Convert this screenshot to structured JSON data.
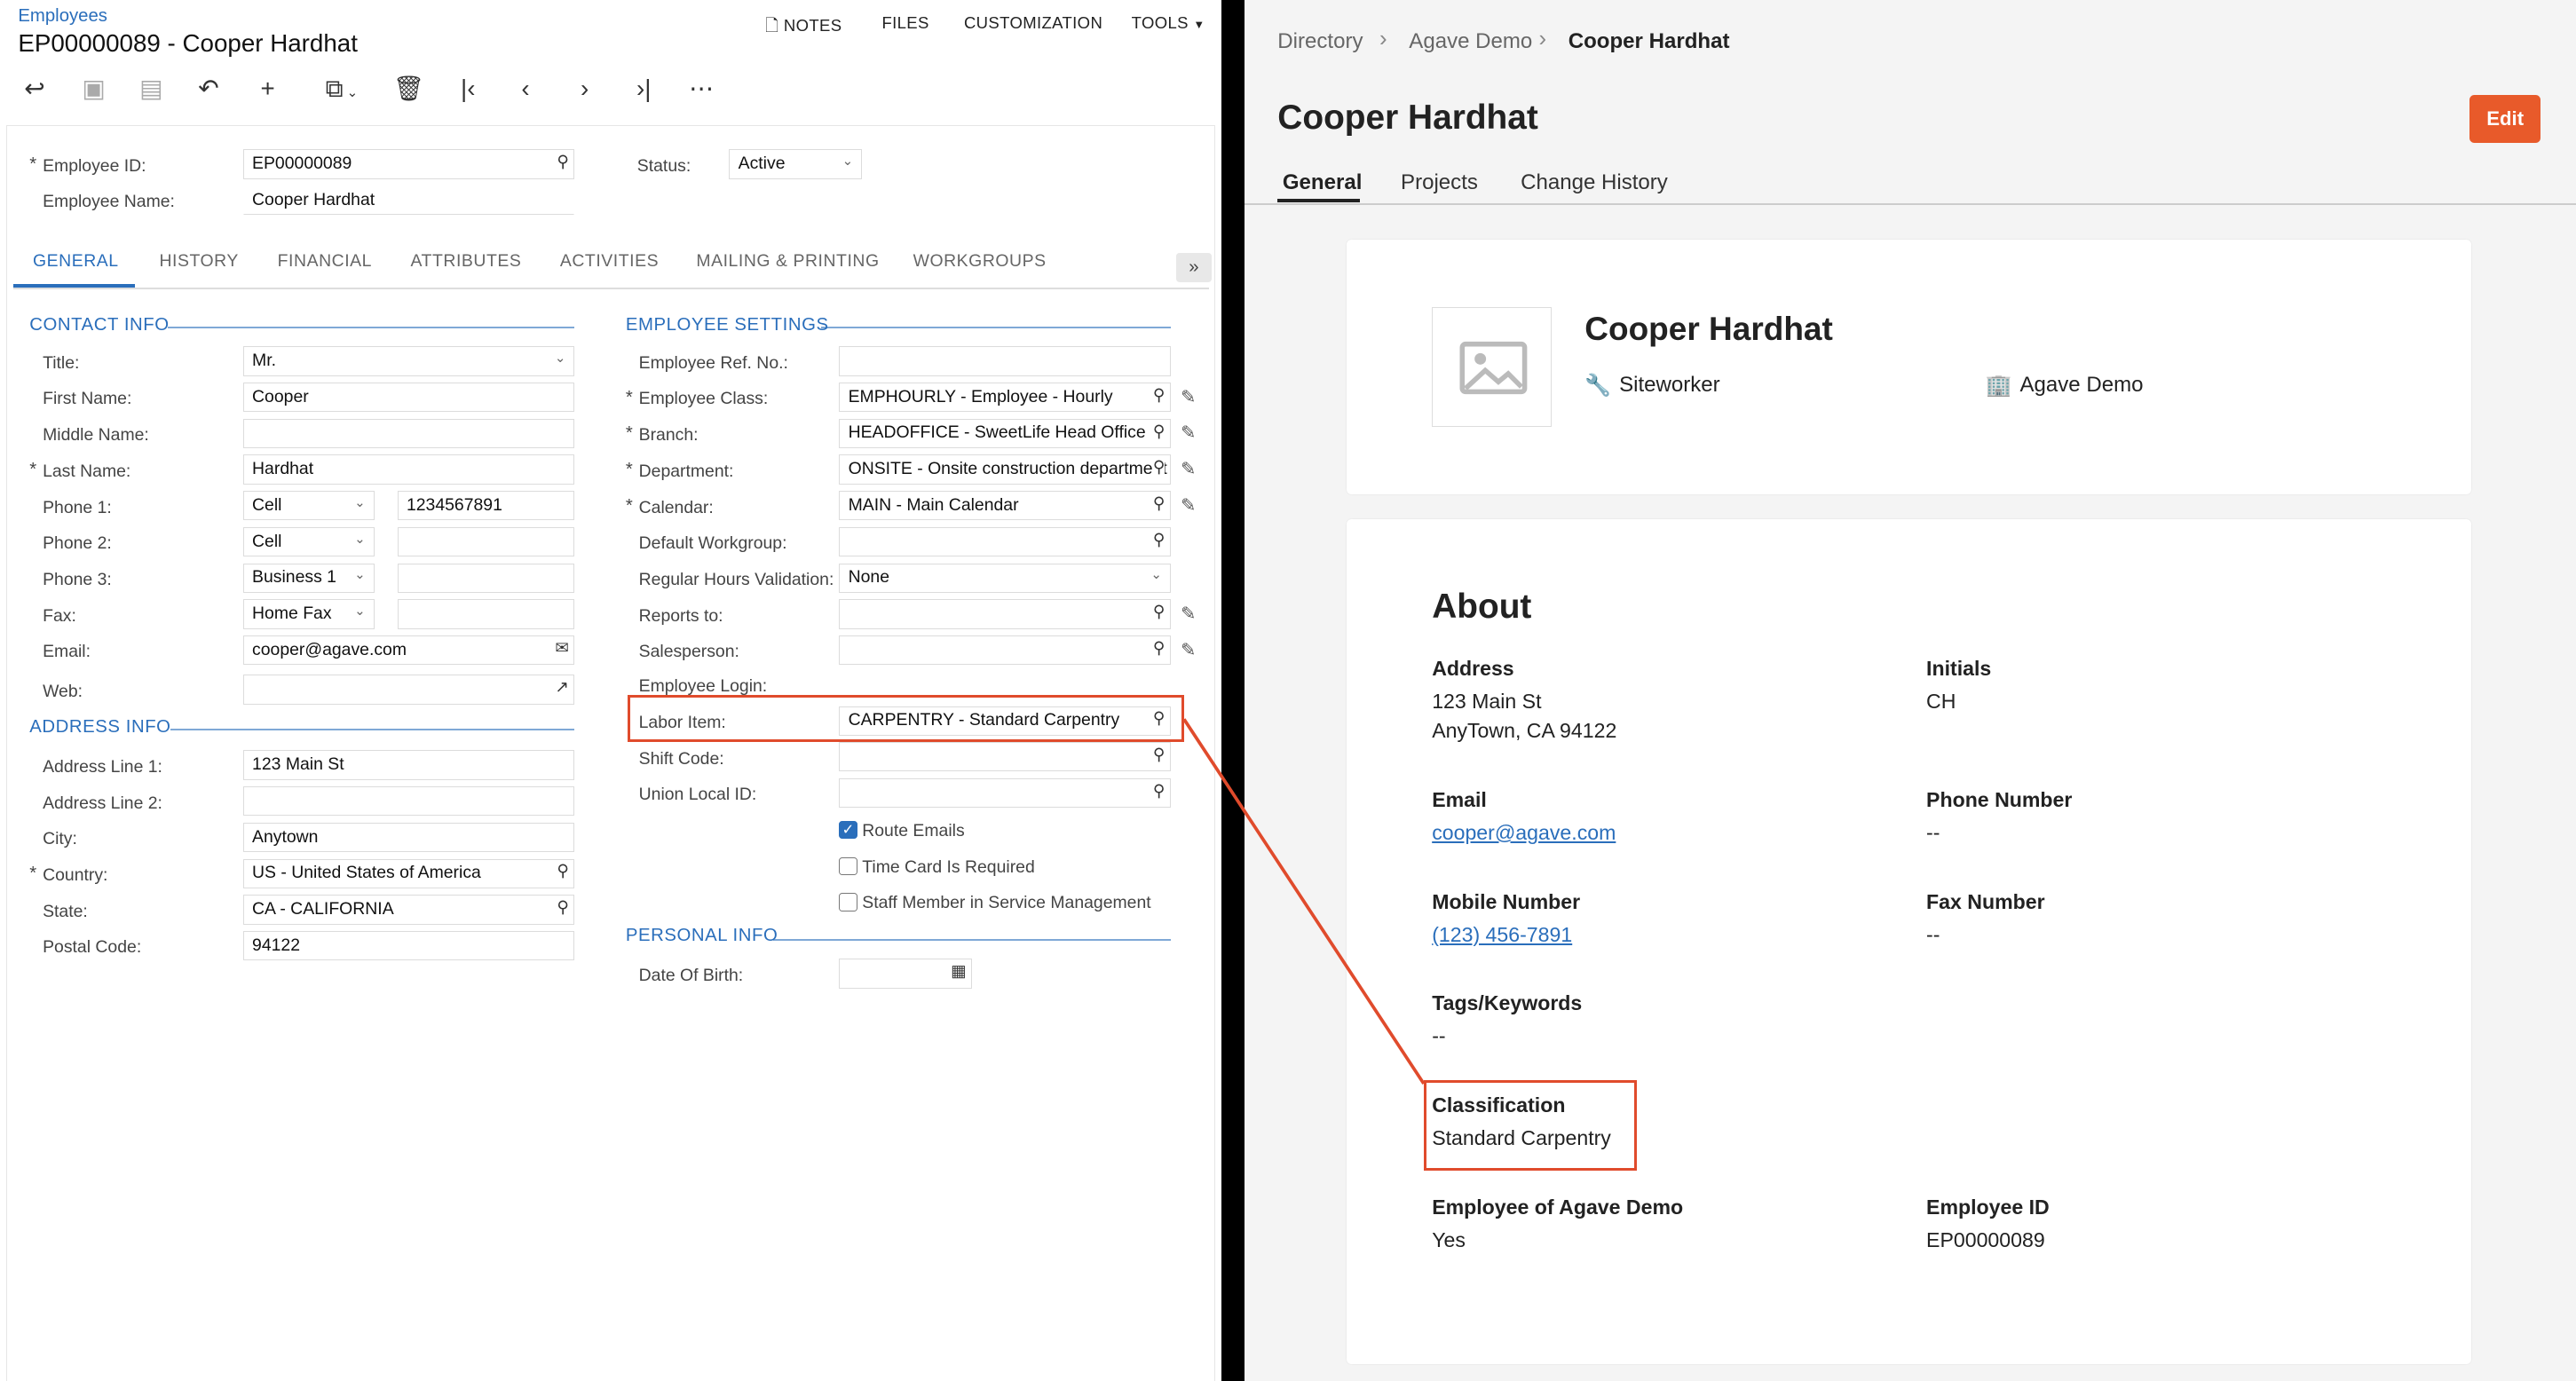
{
  "acumatica": {
    "breadcrumb": "Employees",
    "title": "EP00000089 - Cooper Hardhat",
    "menu": {
      "notes": "NOTES",
      "files": "FILES",
      "customization": "CUSTOMIZATION",
      "tools": "TOOLS"
    },
    "header": {
      "employee_id_label": "Employee ID:",
      "employee_id": "EP00000089",
      "employee_name_label": "Employee Name:",
      "employee_name": "Cooper Hardhat",
      "status_label": "Status:",
      "status": "Active"
    },
    "tabs": [
      "GENERAL",
      "HISTORY",
      "FINANCIAL",
      "ATTRIBUTES",
      "ACTIVITIES",
      "MAILING & PRINTING",
      "WORKGROUPS"
    ],
    "contact_info": {
      "heading": "CONTACT INFO",
      "title_label": "Title:",
      "title": "Mr.",
      "first_name_label": "First Name:",
      "first_name": "Cooper",
      "middle_name_label": "Middle Name:",
      "middle_name": "",
      "last_name_label": "Last Name:",
      "last_name": "Hardhat",
      "phone1_label": "Phone 1:",
      "phone1_type": "Cell",
      "phone1": "1234567891",
      "phone2_label": "Phone 2:",
      "phone2_type": "Cell",
      "phone2": "",
      "phone3_label": "Phone 3:",
      "phone3_type": "Business 1",
      "phone3": "",
      "fax_label": "Fax:",
      "fax_type": "Home Fax",
      "fax": "",
      "email_label": "Email:",
      "email": "cooper@agave.com",
      "web_label": "Web:",
      "web": ""
    },
    "address_info": {
      "heading": "ADDRESS INFO",
      "line1_label": "Address Line 1:",
      "line1": "123 Main St",
      "line2_label": "Address Line 2:",
      "line2": "",
      "city_label": "City:",
      "city": "Anytown",
      "country_label": "Country:",
      "country": "US - United States of America",
      "state_label": "State:",
      "state": "CA - CALIFORNIA",
      "postal_label": "Postal Code:",
      "postal": "94122"
    },
    "employee_settings": {
      "heading": "EMPLOYEE SETTINGS",
      "ref_label": "Employee Ref. No.:",
      "ref": "",
      "class_label": "Employee Class:",
      "class": "EMPHOURLY - Employee - Hourly",
      "branch_label": "Branch:",
      "branch": "HEADOFFICE - SweetLife Head Office",
      "department_label": "Department:",
      "department": "ONSITE - Onsite construction department",
      "calendar_label": "Calendar:",
      "calendar": "MAIN - Main Calendar",
      "workgroup_label": "Default Workgroup:",
      "workgroup": "",
      "regular_hours_label": "Regular Hours Validation:",
      "regular_hours": "None",
      "reports_to_label": "Reports to:",
      "reports_to": "",
      "salesperson_label": "Salesperson:",
      "salesperson": "",
      "login_label": "Employee Login:",
      "labor_item_label": "Labor Item:",
      "labor_item": "CARPENTRY - Standard Carpentry",
      "shift_label": "Shift Code:",
      "shift": "",
      "union_label": "Union Local ID:",
      "union": "",
      "route_emails": "Route Emails",
      "time_card": "Time Card Is Required",
      "staff_member": "Staff Member in Service Management"
    },
    "personal_info": {
      "heading": "PERSONAL INFO",
      "dob_label": "Date Of Birth:",
      "dob": ""
    }
  },
  "agave": {
    "breadcrumb": [
      "Directory",
      "Agave Demo",
      "Cooper Hardhat"
    ],
    "title": "Cooper Hardhat",
    "edit": "Edit",
    "tabs": [
      "General",
      "Projects",
      "Change History"
    ],
    "profile": {
      "name": "Cooper Hardhat",
      "role": "Siteworker",
      "company": "Agave Demo"
    },
    "about": {
      "heading": "About",
      "address_label": "Address",
      "address_line1": "123 Main St",
      "address_line2": "AnyTown, CA 94122",
      "initials_label": "Initials",
      "initials": "CH",
      "email_label": "Email",
      "email": "cooper@agave.com",
      "phone_label": "Phone Number",
      "phone": "--",
      "mobile_label": "Mobile Number",
      "mobile": "(123) 456-7891",
      "fax_label": "Fax Number",
      "fax": "--",
      "tags_label": "Tags/Keywords",
      "tags": "--",
      "classification_label": "Classification",
      "classification": "Standard Carpentry",
      "employee_of_label": "Employee of Agave Demo",
      "employee_of": "Yes",
      "employee_id_label": "Employee ID",
      "employee_id": "EP00000089"
    }
  },
  "colors": {
    "accent_blue": "#2a6ebb",
    "highlight": "#e04b2c",
    "edit_button": "#e85a2a"
  }
}
